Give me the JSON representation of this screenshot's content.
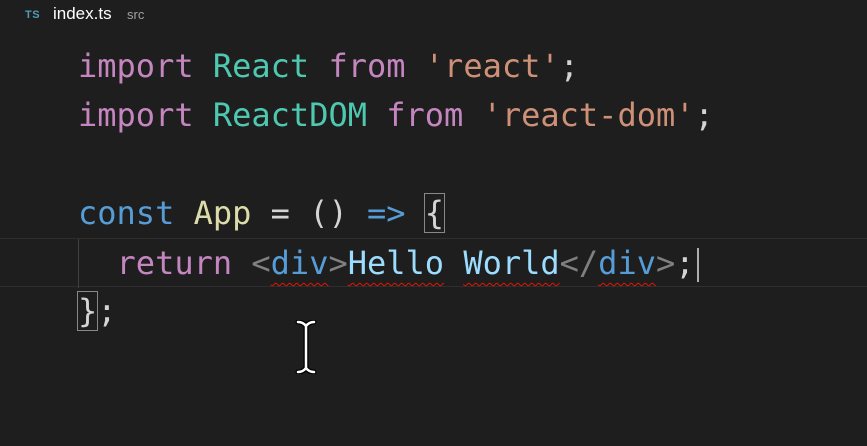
{
  "tab": {
    "lang_badge": "TS",
    "filename": "index.ts",
    "folder": "src"
  },
  "code": {
    "line1": {
      "kw": "import",
      "name": "React",
      "from": "from",
      "module": "'react'",
      "semi": ";"
    },
    "line2": {
      "kw": "import",
      "name": "ReactDOM",
      "from": "from",
      "module": "'react-dom'",
      "semi": ";"
    },
    "line4": {
      "kw": "const",
      "name": "App",
      "eq": "=",
      "parens": "()",
      "arrow": "=>",
      "brace": "{"
    },
    "line5": {
      "kw": "return",
      "open_lt": "<",
      "open_tag": "div",
      "open_gt": ">",
      "text1": "Hello",
      "text2": "World",
      "close_lt": "</",
      "close_tag": "div",
      "close_gt": ">",
      "semi": ";"
    },
    "line6": {
      "brace": "}",
      "semi": ";"
    }
  },
  "colors": {
    "background": "#1e1e1e",
    "keyword_import": "#c586c0",
    "keyword_const": "#569cd6",
    "identifier": "#9cdcfe",
    "string": "#ce9178",
    "error_squiggle": "#e51400"
  }
}
